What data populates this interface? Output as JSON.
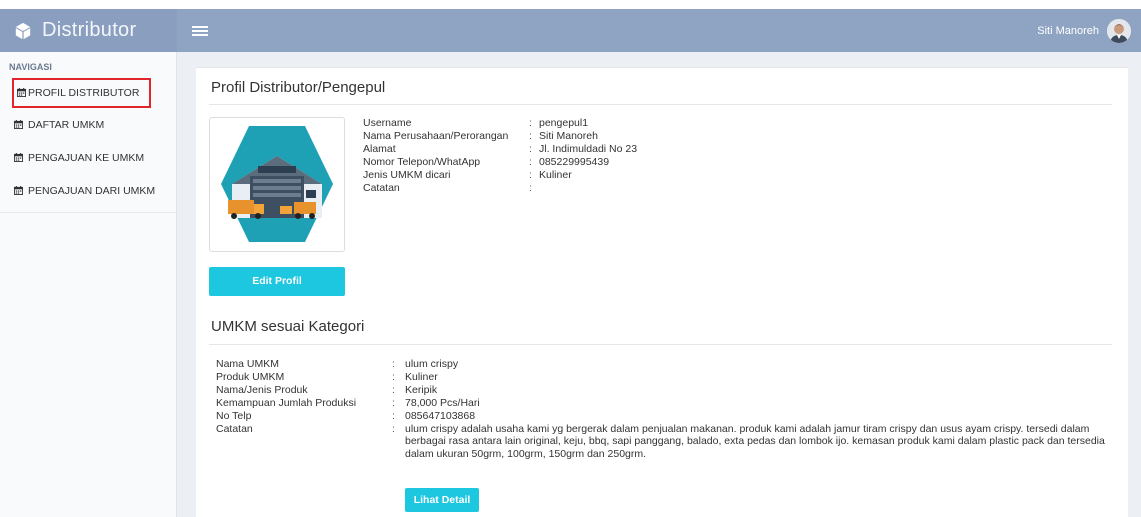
{
  "header": {
    "brand": "Distributor",
    "user_name": "Siti Manoreh",
    "brand_color": "#8fa3c3"
  },
  "sidebar": {
    "heading": "NAVIGASI",
    "items": [
      {
        "label": "PROFIL DISTRIBUTOR",
        "icon": "calendar-icon",
        "active": true
      },
      {
        "label": "DAFTAR UMKM",
        "icon": "calendar-icon",
        "active": false
      },
      {
        "label": "PENGAJUAN KE UMKM",
        "icon": "calendar-icon",
        "active": false
      },
      {
        "label": "PENGAJUAN DARI UMKM",
        "icon": "calendar-icon",
        "active": false
      }
    ]
  },
  "profile": {
    "title": "Profil Distributor/Pengepul",
    "edit_button": "Edit Profil",
    "fields": [
      {
        "label": "Username",
        "value": "pengepul1"
      },
      {
        "label": "Nama Perusahaan/Perorangan",
        "value": "Siti Manoreh"
      },
      {
        "label": "Alamat",
        "value": "Jl. Indimuldadi No 23"
      },
      {
        "label": "Nomor Telepon/WhatApp",
        "value": "085229995439"
      },
      {
        "label": "Jenis UMKM dicari",
        "value": "Kuliner"
      },
      {
        "label": "Catatan",
        "value": ""
      }
    ]
  },
  "umkm": {
    "title": "UMKM sesuai Kategori",
    "detail_button": "Lihat Detail",
    "fields": [
      {
        "label": "Nama UMKM",
        "value": "ulum crispy"
      },
      {
        "label": "Produk UMKM",
        "value": "Kuliner"
      },
      {
        "label": "Nama/Jenis Produk",
        "value": "Keripik"
      },
      {
        "label": "Kemampuan Jumlah Produksi",
        "value": "78,000 Pcs/Hari"
      },
      {
        "label": "No Telp",
        "value": "085647103868"
      },
      {
        "label": "Catatan",
        "value": "ulum crispy adalah usaha kami yg bergerak dalam penjualan makanan. produk kami adalah jamur tiram crispy dan usus ayam crispy. tersedi dalam berbagai rasa antara lain original, keju, bbq, sapi panggang, balado, exta pedas dan lombok ijo. kemasan produk kami dalam plastic pack dan tersedia dalam ukuran 50grm, 100grm, 150grm dan 250grm."
      }
    ]
  },
  "colors": {
    "accent_button": "#1cc7df",
    "active_outline": "#e0262b"
  }
}
